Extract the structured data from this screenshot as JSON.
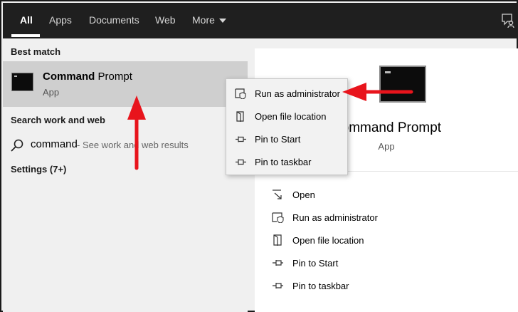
{
  "tabs": [
    {
      "label": "All",
      "active": true
    },
    {
      "label": "Apps"
    },
    {
      "label": "Documents"
    },
    {
      "label": "Web"
    },
    {
      "label": "More"
    }
  ],
  "left": {
    "best_match_title": "Best match",
    "best_match": {
      "name_bold": "Command",
      "name_rest": " Prompt",
      "type": "App"
    },
    "search_web_title": "Search work and web",
    "search_term": "command",
    "search_hint": " - See work and web results",
    "settings_title": "Settings (7+)"
  },
  "context_menu": [
    {
      "label": "Run as administrator",
      "icon": "shield-icon"
    },
    {
      "label": "Open file location",
      "icon": "folder-icon"
    },
    {
      "label": "Pin to Start",
      "icon": "pin-icon"
    },
    {
      "label": "Pin to taskbar",
      "icon": "pin-icon"
    }
  ],
  "right": {
    "title": "Command Prompt",
    "subtitle": "App",
    "actions": [
      {
        "label": "Open",
        "icon": "open-icon"
      },
      {
        "label": "Run as administrator",
        "icon": "shield-icon"
      },
      {
        "label": "Open file location",
        "icon": "folder-icon"
      },
      {
        "label": "Pin to Start",
        "icon": "pin-icon"
      },
      {
        "label": "Pin to taskbar",
        "icon": "pin-icon"
      }
    ]
  },
  "colors": {
    "annotation_arrow": "#e8141c",
    "topbar": "#1f1f1f",
    "highlight": "#cfcfcf"
  }
}
